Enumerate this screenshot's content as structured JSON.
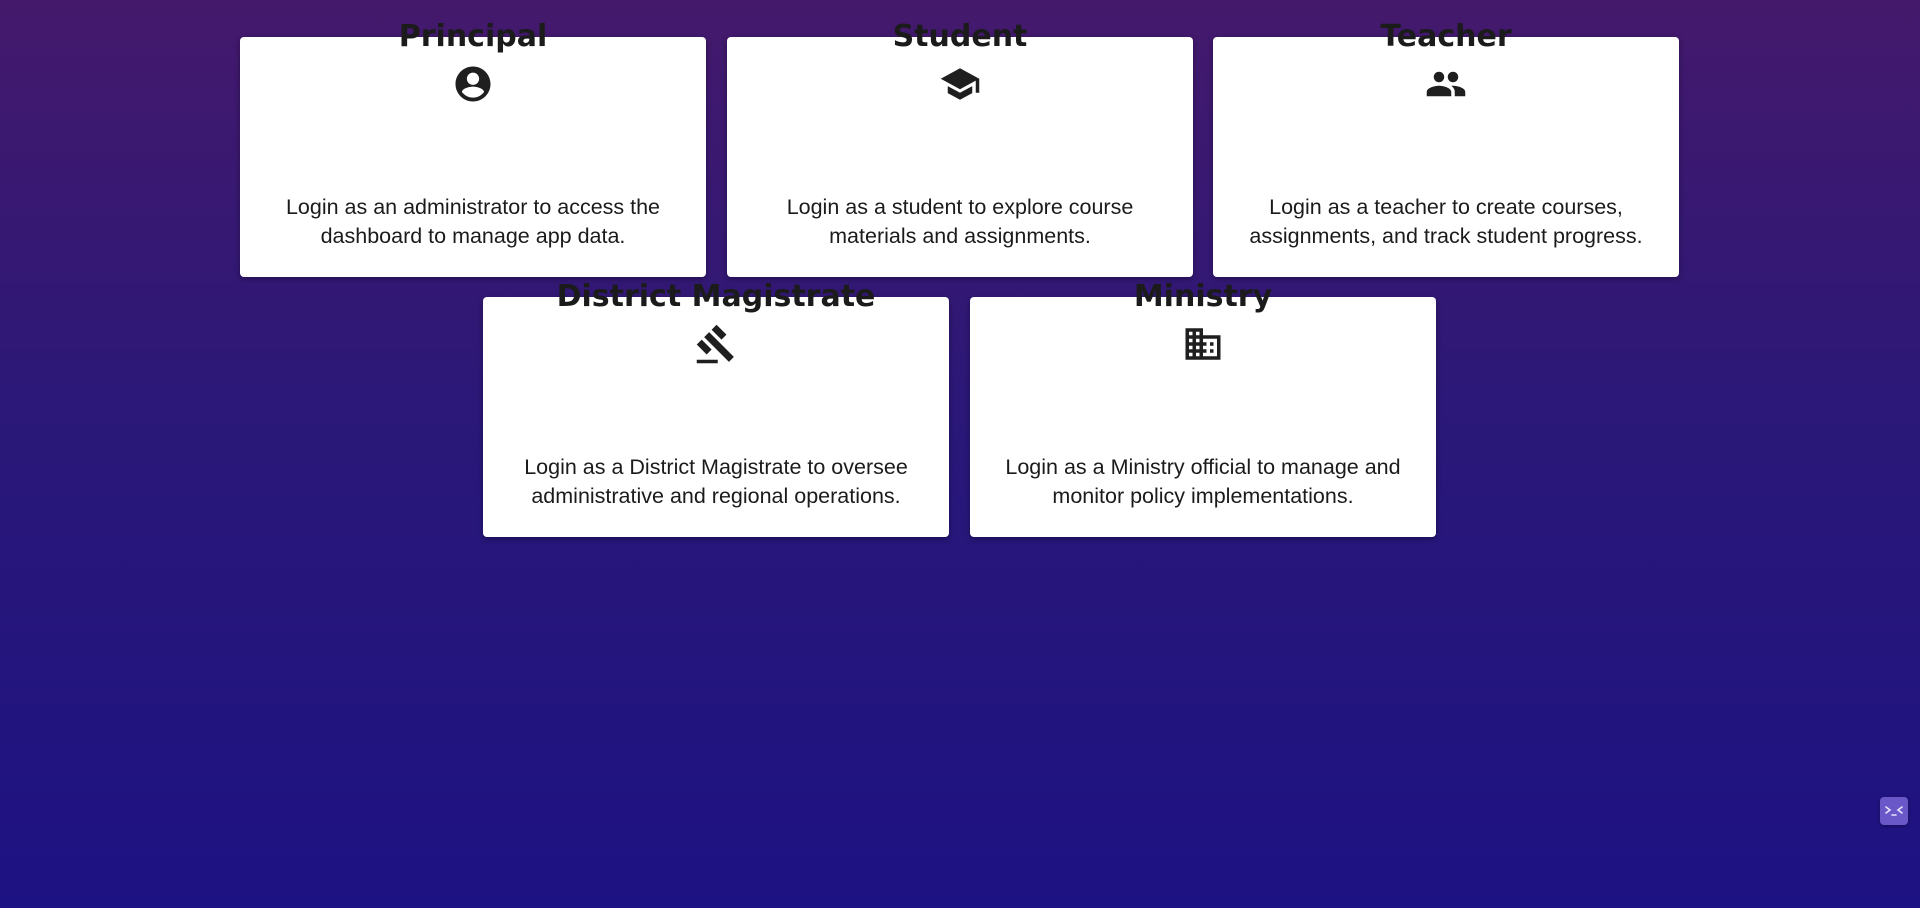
{
  "cards": [
    {
      "icon": "account-circle-icon",
      "title": "Principal",
      "description": "Login as an administrator to access the dashboard to manage app data."
    },
    {
      "icon": "graduation-cap-icon",
      "title": "Student",
      "description": "Login as a student to explore course materials and assignments."
    },
    {
      "icon": "people-icon",
      "title": "Teacher",
      "description": "Login as a teacher to create courses, assignments, and track student progress."
    },
    {
      "icon": "gavel-icon",
      "title": "District Magistrate",
      "description": "Login as a District Magistrate to oversee administrative and regional operations."
    },
    {
      "icon": "building-icon",
      "title": "Ministry",
      "description": "Login as a Ministry official to manage and monitor policy implementations."
    }
  ],
  "floating_button": {
    "icon": "face-icon"
  },
  "colors": {
    "background_top": "#44196c",
    "background_bottom": "#1d1283",
    "card_background": "#ffffff",
    "text": "#1b1b1b",
    "floating_button": "#6a58c9"
  }
}
